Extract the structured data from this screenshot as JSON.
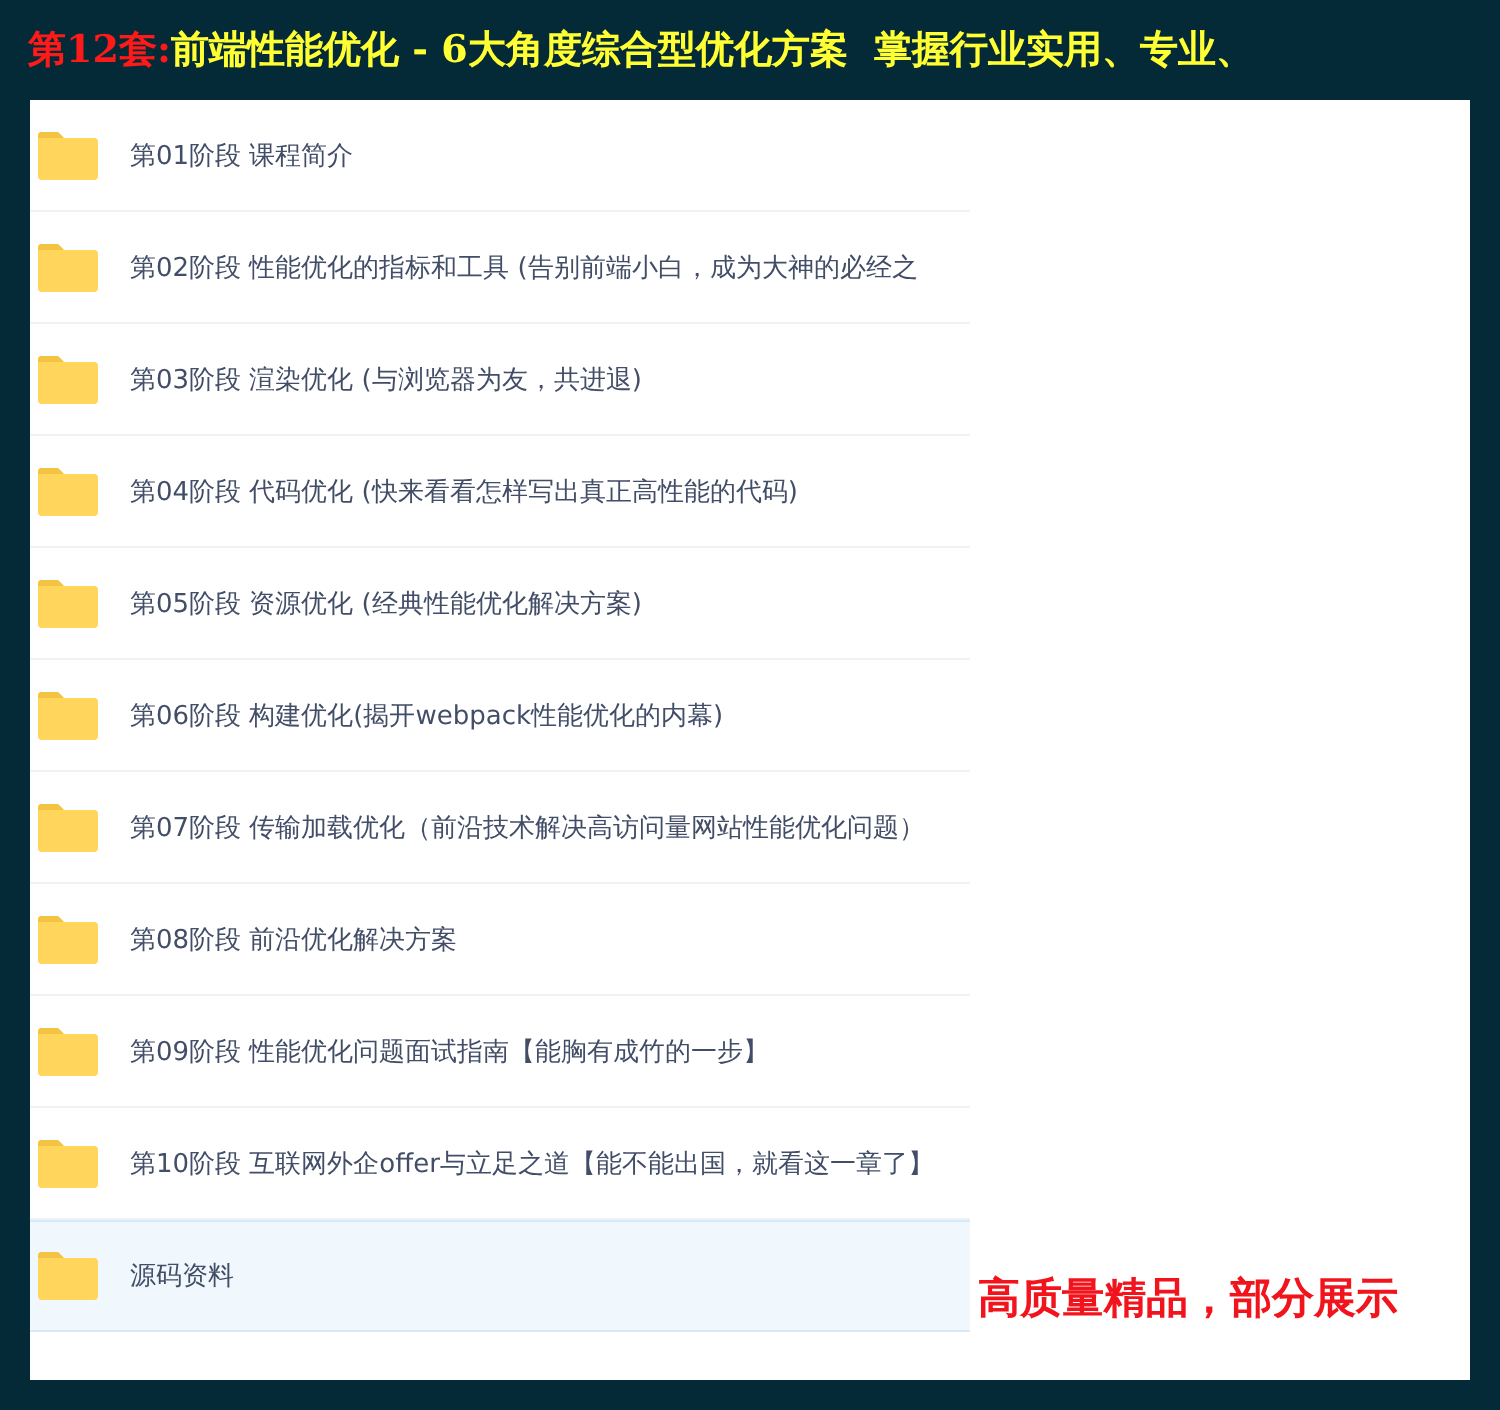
{
  "banner": {
    "prefix": "第12套:",
    "title": "前端性能优化 - 6大角度综合型优化方案  掌握行业实用、专业、"
  },
  "folders": [
    {
      "name": "第01阶段 课程简介",
      "selected": false
    },
    {
      "name": "第02阶段 性能优化的指标和工具 (告别前端小白，成为大神的必经之",
      "selected": false
    },
    {
      "name": "第03阶段 渲染优化 (与浏览器为友，共进退)",
      "selected": false
    },
    {
      "name": "第04阶段 代码优化 (快来看看怎样写出真正高性能的代码)",
      "selected": false
    },
    {
      "name": "第05阶段 资源优化 (经典性能优化解决方案)",
      "selected": false
    },
    {
      "name": "第06阶段 构建优化(揭开webpack性能优化的内幕)",
      "selected": false
    },
    {
      "name": "第07阶段 传输加载优化（前沿技术解决高访问量网站性能优化问题）",
      "selected": false
    },
    {
      "name": "第08阶段 前沿优化解决方案",
      "selected": false
    },
    {
      "name": "第09阶段 性能优化问题面试指南【能胸有成竹的一步】",
      "selected": false
    },
    {
      "name": "第10阶段 互联网外企offer与立足之道【能不能出国，就看这一章了】",
      "selected": false
    },
    {
      "name": "源码资料",
      "selected": true
    }
  ],
  "note": "高质量精品，部分展示"
}
